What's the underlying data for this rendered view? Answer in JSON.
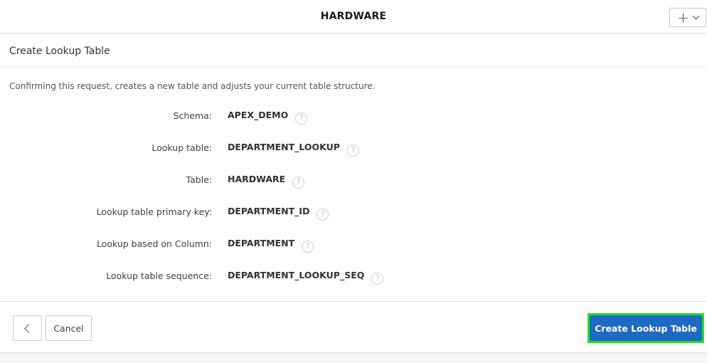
{
  "header": {
    "title": "HARDWARE",
    "add_menu_icon": "plus-icon",
    "add_menu_chevron_icon": "chevron-down-icon"
  },
  "region": {
    "title": "Create Lookup Table",
    "intro": "Confirming this request, creates a new table and adjusts your current table structure.",
    "fields": [
      {
        "label": "Schema:",
        "value": "APEX_DEMO"
      },
      {
        "label": "Lookup table:",
        "value": "DEPARTMENT_LOOKUP"
      },
      {
        "label": "Table:",
        "value": "HARDWARE"
      },
      {
        "label": "Lookup table primary key:",
        "value": "DEPARTMENT_ID"
      },
      {
        "label": "Lookup based on Column:",
        "value": "DEPARTMENT"
      },
      {
        "label": "Lookup table sequence:",
        "value": "DEPARTMENT_LOOKUP_SEQ"
      }
    ],
    "help_icon_glyph": "?"
  },
  "footer": {
    "back_icon": "chevron-left-icon",
    "cancel_label": "Cancel",
    "create_label": "Create Lookup Table"
  },
  "colors": {
    "primary_button": "#1f69c4",
    "highlight_outline": "#22e022"
  }
}
